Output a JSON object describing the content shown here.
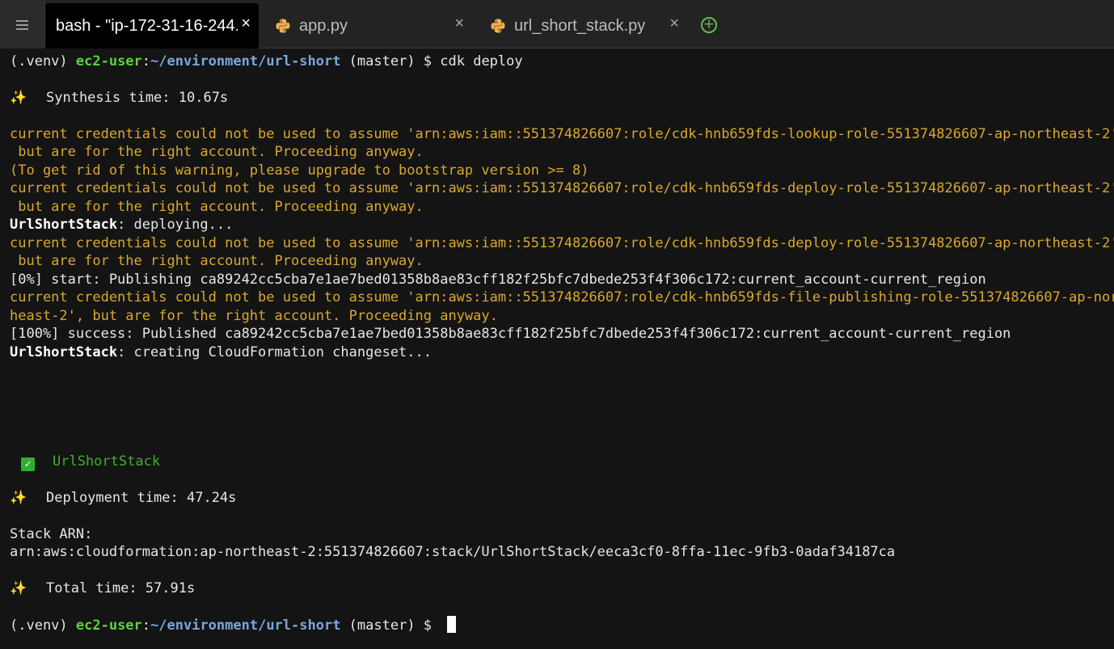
{
  "tabs": [
    {
      "label": "bash - \"ip-172-31-16-244.",
      "close": "×",
      "icon": "terminal",
      "active": true
    },
    {
      "label": "app.py",
      "close": "×",
      "icon": "python-icon",
      "active": false
    },
    {
      "label": "url_short_stack.py",
      "close": "×",
      "icon": "python-icon",
      "active": false
    }
  ],
  "new_tab_icon": "+",
  "colors": {
    "prompt_user": "#58d43e",
    "prompt_path": "#7aa6dd",
    "warning": "#d9a82d",
    "success_stack": "#3fae2e",
    "background": "#141414"
  },
  "terminal": {
    "prompt": {
      "venv": "(.venv) ",
      "user": "ec2-user",
      "sep": ":",
      "path": "~/environment/url-short",
      "branch": " (master) $ ",
      "command": "cdk deploy"
    },
    "sparkle_icon": "✨",
    "check_icon": "✓",
    "synthesis": "Synthesis time: 10.67s",
    "lines": {
      "w1a": "current credentials could not be used to assume 'arn:aws:iam::551374826607:role/cdk-hnb659fds-lookup-role-551374826607-ap-northeast-2',",
      "w1b": " but are for the right account. Proceeding anyway.",
      "w2": "(To get rid of this warning, please upgrade to bootstrap version >= 8)",
      "w3a": "current credentials could not be used to assume 'arn:aws:iam::551374826607:role/cdk-hnb659fds-deploy-role-551374826607-ap-northeast-2',",
      "w3b": " but are for the right account. Proceeding anyway.",
      "deploy_stack": "UrlShortStack",
      "deploy_msg": ": deploying...",
      "w4a": "current credentials could not be used to assume 'arn:aws:iam::551374826607:role/cdk-hnb659fds-deploy-role-551374826607-ap-northeast-2',",
      "w4b": " but are for the right account. Proceeding anyway.",
      "publish_start": "[0%] start: Publishing ca89242cc5cba7e1ae7bed01358b8ae83cff182f25bfc7dbede253f4f306c172:current_account-current_region",
      "w5a": "current credentials could not be used to assume 'arn:aws:iam::551374826607:role/cdk-hnb659fds-file-publishing-role-551374826607-ap-nort",
      "w5b": "heast-2', but are for the right account. Proceeding anyway.",
      "publish_done": "[100%] success: Published ca89242cc5cba7e1ae7bed01358b8ae83cff182f25bfc7dbede253f4f306c172:current_account-current_region",
      "changeset_stack": "UrlShortStack",
      "changeset_msg": ": creating CloudFormation changeset...",
      "success_stack": "UrlShortStack",
      "deployment_time": "Deployment time: 47.24s",
      "stack_arn_label": "Stack ARN:",
      "stack_arn": "arn:aws:cloudformation:ap-northeast-2:551374826607:stack/UrlShortStack/eeca3cf0-8ffa-11ec-9fb3-0adaf34187ca",
      "total_time": "Total time: 57.91s"
    }
  }
}
